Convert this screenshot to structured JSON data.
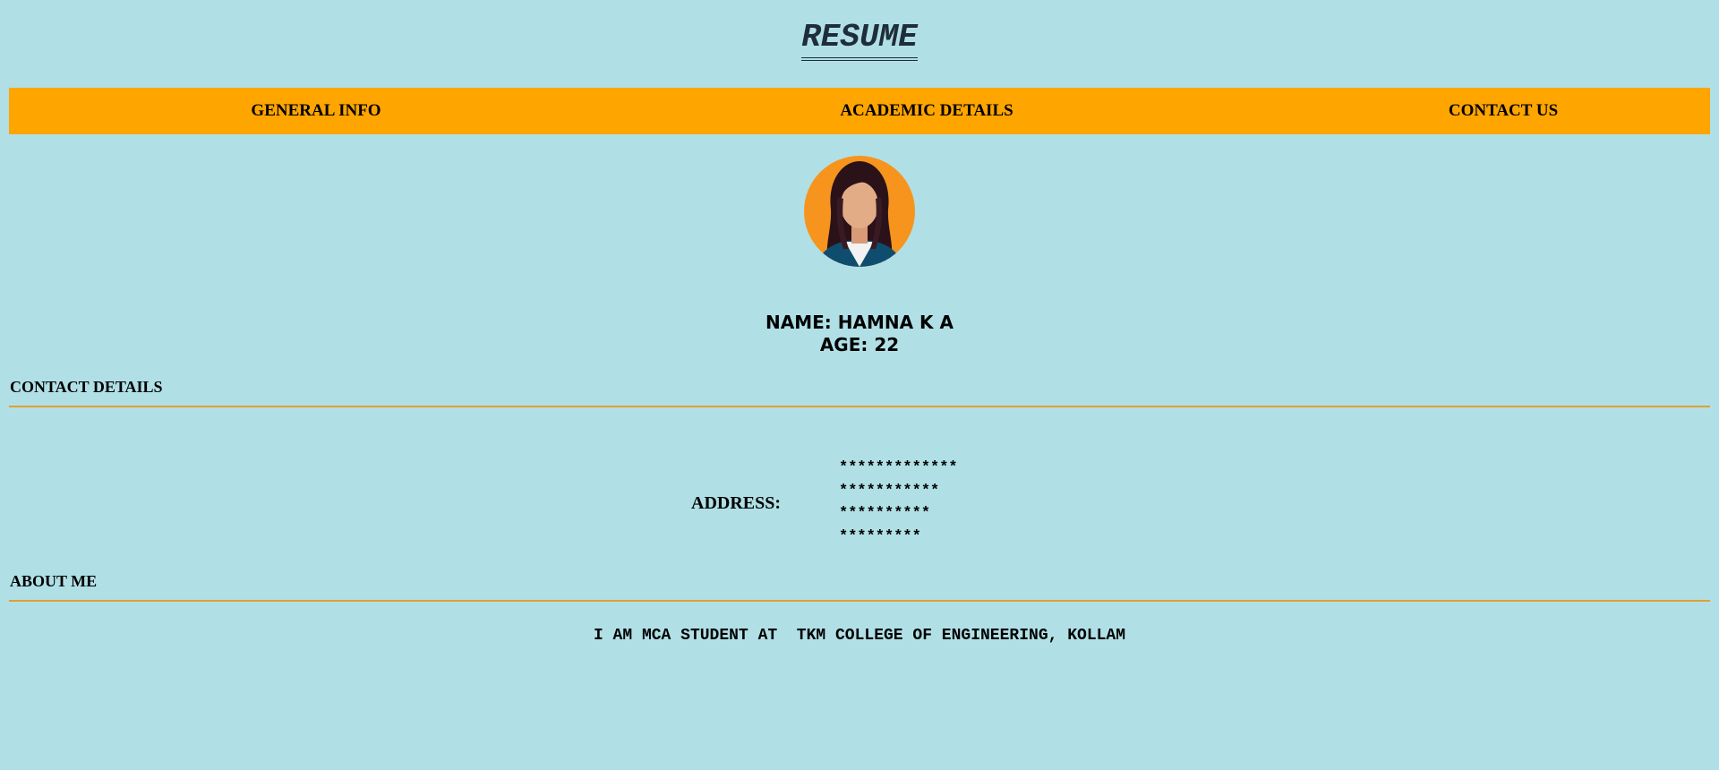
{
  "header": {
    "title": "RESUME"
  },
  "nav": {
    "items": [
      {
        "label": "GENERAL INFO"
      },
      {
        "label": "ACADEMIC DETAILS"
      },
      {
        "label": "CONTACT US"
      }
    ]
  },
  "profile": {
    "avatar_icon": "woman-avatar-icon",
    "name_line": "NAME: HAMNA K A",
    "age_line": "AGE: 22"
  },
  "contact": {
    "heading": "CONTACT DETAILS",
    "address_label": "ADDRESS:",
    "address_lines": [
      "*************",
      "***********",
      "**********",
      "*********"
    ]
  },
  "about": {
    "heading": "ABOUT ME",
    "text": "I AM MCA STUDENT AT  TKM COLLEGE OF ENGINEERING, KOLLAM"
  },
  "colors": {
    "background": "#b0e0e6",
    "navbar": "#ffa500",
    "divider": "#e0a030",
    "avatar_circle": "#f7941d"
  }
}
